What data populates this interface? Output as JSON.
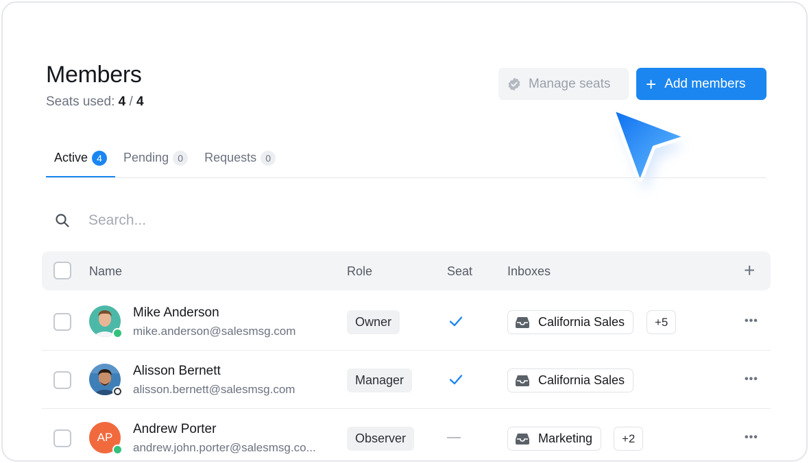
{
  "header": {
    "title": "Members",
    "seats_label": "Seats used:",
    "seats_used": "4",
    "seats_separator": "/",
    "seats_total": "4"
  },
  "actions": {
    "manage_seats": "Manage seats",
    "add_members": "Add members"
  },
  "tabs": [
    {
      "label": "Active",
      "count": "4",
      "active": true
    },
    {
      "label": "Pending",
      "count": "0",
      "active": false
    },
    {
      "label": "Requests",
      "count": "0",
      "active": false
    }
  ],
  "search": {
    "placeholder": "Search...",
    "value": ""
  },
  "table": {
    "columns": {
      "name": "Name",
      "role": "Role",
      "seat": "Seat",
      "inboxes": "Inboxes"
    },
    "rows": [
      {
        "name": "Mike Anderson",
        "email": "mike.anderson@salesmsg.com",
        "role": "Owner",
        "seat": true,
        "status": "online",
        "avatar": "photo",
        "inbox": "California Sales",
        "inbox_more": "+5"
      },
      {
        "name": "Alisson Bernett",
        "email": "alisson.bernett@salesmsg.com",
        "role": "Manager",
        "seat": true,
        "status": "offline",
        "avatar": "photo",
        "inbox": "California Sales",
        "inbox_more": ""
      },
      {
        "name": "Andrew Porter",
        "email": "andrew.john.porter@salesmsg.co...",
        "role": "Observer",
        "seat": false,
        "status": "online",
        "avatar_initials": "AP",
        "inbox": "Marketing",
        "inbox_more": "+2"
      }
    ]
  },
  "colors": {
    "accent": "#1b86f0",
    "online": "#34c17b",
    "initials_avatar": "#f16a3d"
  },
  "icons": {
    "manage": "badge-check-icon",
    "add": "plus-icon",
    "search": "search-icon",
    "inbox": "inbox-tray-icon",
    "seat": "checkmark-icon",
    "row_menu": "more-horizontal-icon",
    "add_column": "plus-icon"
  }
}
